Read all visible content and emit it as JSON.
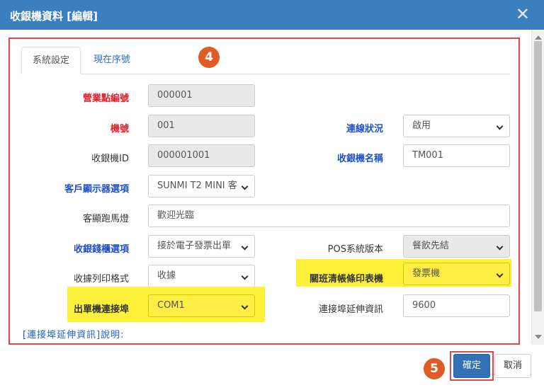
{
  "dialog": {
    "title": "收銀機資料 [編輯]",
    "close_glyph": "✕"
  },
  "tabs": [
    {
      "label": "系統設定",
      "active": true
    },
    {
      "label": "現在序號",
      "active": false
    }
  ],
  "badges": {
    "step4": "4",
    "step5": "5"
  },
  "form": {
    "store_no": {
      "label": "營業點編號",
      "value": "000001"
    },
    "machine_no": {
      "label": "機號",
      "value": "001"
    },
    "connection_status": {
      "label": "連線狀況",
      "value": "啟用"
    },
    "pos_id": {
      "label": "收銀機ID",
      "value": "000001001"
    },
    "pos_name": {
      "label": "收銀機名稱",
      "value": "TM001"
    },
    "customer_display": {
      "label": "客戶顯示器選項",
      "value": "SUNMI T2 MINI 客"
    },
    "marquee": {
      "label": "客顯跑馬燈",
      "value": "歡迎光臨"
    },
    "cash_drawer": {
      "label": "收銀錢櫃選項",
      "value": "接於電子發票出單"
    },
    "pos_version": {
      "label": "POS系統版本",
      "value": "餐飲先結"
    },
    "receipt_format": {
      "label": "收據列印格式",
      "value": "收據"
    },
    "shift_report_printer": {
      "label": "關班清帳條印表機",
      "value": "發票機"
    },
    "printer_port": {
      "label": "出單機連接埠",
      "value": "COM1"
    },
    "port_extra": {
      "label": "連接埠延伸資訊",
      "value": "9600"
    }
  },
  "hint": "[連接埠延伸資訊]說明:",
  "buttons": {
    "confirm": "確定",
    "cancel": "取消"
  },
  "colors": {
    "titlebar": "#3c7fbf",
    "required_label": "#e0202a",
    "link_label": "#2050c8",
    "highlight": "#fff03a",
    "annotation": "#e54545",
    "badge": "#e15b25",
    "primary_button": "#3271b5"
  }
}
